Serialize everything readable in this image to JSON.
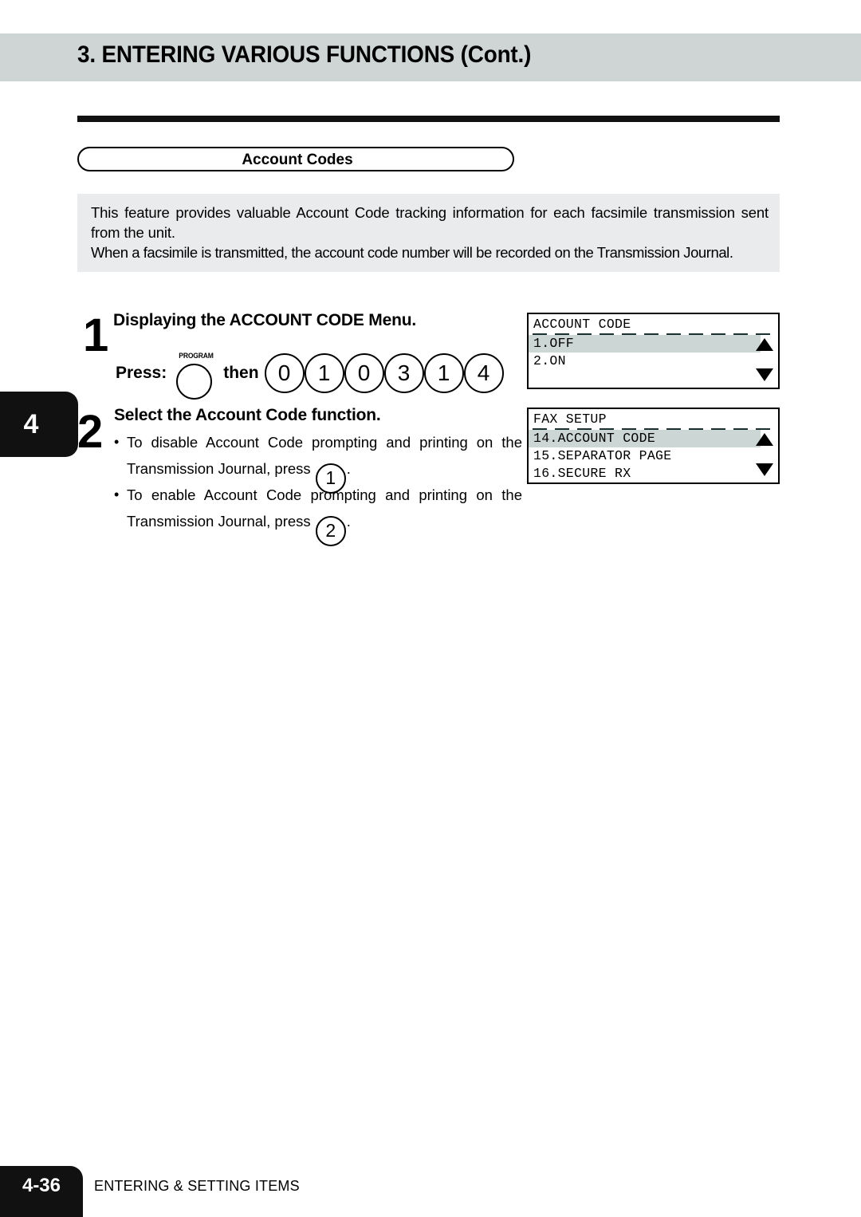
{
  "header": {
    "title": "3. ENTERING VARIOUS FUNCTIONS (Cont.)"
  },
  "section": {
    "pill_label": "Account Codes"
  },
  "intro": {
    "paragraph_1": "This feature provides valuable Account Code tracking information for each facsimile transmission sent from the unit.",
    "paragraph_2": "When a facsimile is transmitted, the account code number will be recorded on the Transmission Journal."
  },
  "chapter_tab": {
    "number": "4"
  },
  "steps": [
    {
      "number": "1",
      "title": "Displaying the ACCOUNT CODE Menu.",
      "press_label": "Press:",
      "program_button_caption": "PROGRAM",
      "then_label": "then",
      "key_sequence": [
        "0",
        "1",
        "0",
        "3",
        "1",
        "4"
      ]
    },
    {
      "number": "2",
      "title": "Select the Account Code function.",
      "bullets": [
        {
          "dot": "•",
          "line_1": "To disable Account Code prompting and printing on the",
          "line_2_prefix": "Transmission Journal, press",
          "key": "1",
          "line_2_suffix": "."
        },
        {
          "dot": "•",
          "line_1": "To enable Account Code prompting and printing on the",
          "line_2_prefix": "Transmission Journal, press",
          "key": "2",
          "line_2_suffix": "."
        }
      ]
    }
  ],
  "lcd_panels": [
    {
      "title": "ACCOUNT CODE",
      "rows": [
        {
          "text": "1.OFF",
          "selected": true
        },
        {
          "text": "2.ON",
          "selected": false
        }
      ],
      "arrow_up": "▲",
      "arrow_down": "▼"
    },
    {
      "title": "FAX SETUP",
      "rows": [
        {
          "text": "14.ACCOUNT CODE",
          "selected": true
        },
        {
          "text": "15.SEPARATOR PAGE",
          "selected": false
        },
        {
          "text": "16.SECURE RX",
          "selected": false
        }
      ],
      "arrow_up": "▲",
      "arrow_down": "▼"
    }
  ],
  "footer": {
    "page_number": "4-36",
    "caption": "ENTERING & SETTING ITEMS"
  },
  "colors": {
    "header_band": "#ced5d4",
    "intro_block": "#eaebec",
    "lcd_highlight": "#ccd6d4",
    "tab_black": "#111111"
  }
}
